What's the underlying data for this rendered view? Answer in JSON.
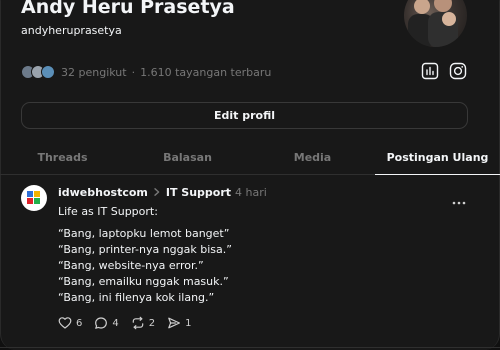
{
  "profile": {
    "name": "Andy Heru Prasetya",
    "handle": "andyheruprasetya",
    "followers_text": "32 pengikut",
    "views_text": "1.610 tayangan terbaru",
    "separator": "·"
  },
  "actions": {
    "edit_profile_label": "Edit profil"
  },
  "tabs": [
    {
      "label": "Threads"
    },
    {
      "label": "Balasan"
    },
    {
      "label": "Media"
    },
    {
      "label": "Postingan Ulang"
    }
  ],
  "post": {
    "author": "idwebhostcom",
    "topic": "IT Support",
    "time": "4 hari",
    "lines": [
      "Life as IT Support:",
      "“Bang, laptopku lemot banget”",
      "“Bang, printer-nya nggak bisa.”",
      "“Bang, website-nya error.”",
      "“Bang, emailku nggak masuk.”",
      "“Bang, ini filenya kok ilang.”"
    ],
    "counts": {
      "likes": "6",
      "replies": "4",
      "reposts": "2",
      "shares": "1"
    }
  },
  "icons": {
    "insights": "insights-icon",
    "instagram": "instagram-icon",
    "chevron": "chevron-right-icon",
    "more": "more-icon",
    "heart": "heart-icon",
    "comment": "comment-icon",
    "repost": "repost-icon",
    "share": "share-icon"
  },
  "colors": {
    "background": "#101010",
    "panel": "#181818",
    "text": "#f3f5f7",
    "muted": "#777777",
    "border": "#383838"
  }
}
